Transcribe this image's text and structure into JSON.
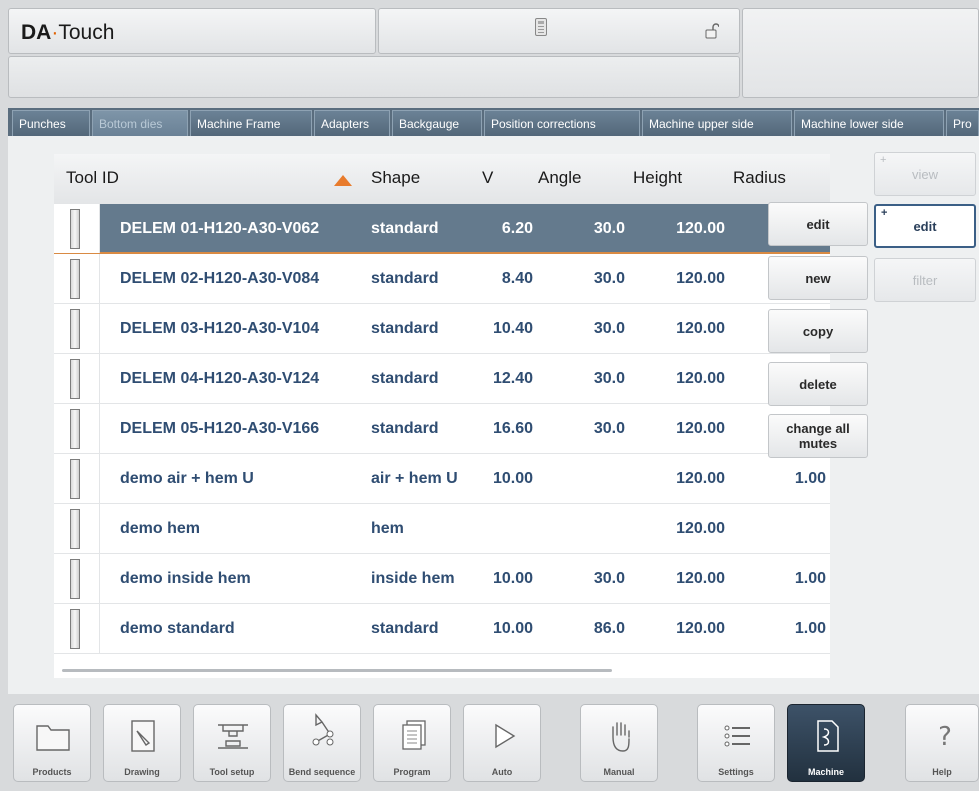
{
  "app": {
    "logo_bold": "DA",
    "logo_dot": "·",
    "logo_rest": "Touch"
  },
  "tabs": [
    "Punches",
    "Bottom dies",
    "Machine Frame",
    "Adapters",
    "Backgauge",
    "Position corrections",
    "Machine upper side",
    "Machine lower side",
    "Pro"
  ],
  "active_tab": "Bottom dies",
  "table": {
    "headers": {
      "tool_id": "Tool ID",
      "shape": "Shape",
      "v": "V",
      "angle": "Angle",
      "height": "Height",
      "radius": "Radius"
    },
    "sort": "ascending",
    "rows": [
      {
        "tool_id": "DELEM 01-H120-A30-V062",
        "shape": "standard",
        "v": "6.20",
        "angle": "30.0",
        "height": "120.00",
        "radius": ""
      },
      {
        "tool_id": "DELEM 02-H120-A30-V084",
        "shape": "standard",
        "v": "8.40",
        "angle": "30.0",
        "height": "120.00",
        "radius": ""
      },
      {
        "tool_id": "DELEM 03-H120-A30-V104",
        "shape": "standard",
        "v": "10.40",
        "angle": "30.0",
        "height": "120.00",
        "radius": ""
      },
      {
        "tool_id": "DELEM 04-H120-A30-V124",
        "shape": "standard",
        "v": "12.40",
        "angle": "30.0",
        "height": "120.00",
        "radius": ""
      },
      {
        "tool_id": "DELEM 05-H120-A30-V166",
        "shape": "standard",
        "v": "16.60",
        "angle": "30.0",
        "height": "120.00",
        "radius": ""
      },
      {
        "tool_id": "demo air + hem U",
        "shape": "air + hem U",
        "v": "10.00",
        "angle": "",
        "height": "120.00",
        "radius": "1.00"
      },
      {
        "tool_id": "demo hem",
        "shape": "hem",
        "v": "",
        "angle": "",
        "height": "120.00",
        "radius": ""
      },
      {
        "tool_id": "demo inside hem",
        "shape": "inside hem",
        "v": "10.00",
        "angle": "30.0",
        "height": "120.00",
        "radius": "1.00"
      },
      {
        "tool_id": "demo standard",
        "shape": "standard",
        "v": "10.00",
        "angle": "86.0",
        "height": "120.00",
        "radius": "1.00"
      }
    ]
  },
  "popup": {
    "edit": "edit",
    "new": "new",
    "copy": "copy",
    "delete": "delete",
    "change_all_mutes": "change all mutes"
  },
  "side": {
    "view": "view",
    "edit": "edit",
    "filter": "filter"
  },
  "nav": {
    "products": "Products",
    "drawing": "Drawing",
    "tool_setup": "Tool setup",
    "bend_sequence": "Bend sequence",
    "program": "Program",
    "auto": "Auto",
    "manual": "Manual",
    "settings": "Settings",
    "machine": "Machine",
    "help": "Help"
  }
}
